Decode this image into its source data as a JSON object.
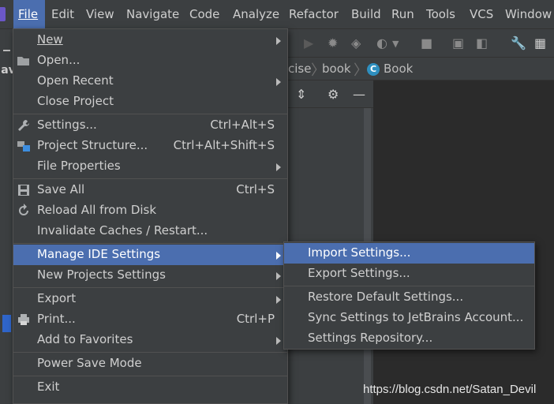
{
  "menubar": {
    "items": [
      "File",
      "Edit",
      "View",
      "Navigate",
      "Code",
      "Analyze",
      "Refactor",
      "Build",
      "Run",
      "Tools",
      "VCS",
      "Window"
    ],
    "active": "File"
  },
  "breadcrumb": {
    "items": [
      "cise",
      "book",
      "Book"
    ]
  },
  "sidebar": {
    "label": "Jav"
  },
  "file_menu": {
    "items": [
      {
        "label": "New",
        "shortcut": "",
        "submenu": true,
        "icon": ""
      },
      {
        "label": "Open...",
        "shortcut": "",
        "submenu": false,
        "icon": "folder-open-icon"
      },
      {
        "label": "Open Recent",
        "shortcut": "",
        "submenu": true,
        "icon": ""
      },
      {
        "label": "Close Project",
        "shortcut": "",
        "submenu": false,
        "icon": ""
      },
      {
        "label": "Settings...",
        "shortcut": "Ctrl+Alt+S",
        "submenu": false,
        "icon": "wrench-icon"
      },
      {
        "label": "Project Structure...",
        "shortcut": "Ctrl+Alt+Shift+S",
        "submenu": false,
        "icon": "project-structure-icon"
      },
      {
        "label": "File Properties",
        "shortcut": "",
        "submenu": true,
        "icon": ""
      },
      {
        "label": "Save All",
        "shortcut": "Ctrl+S",
        "submenu": false,
        "icon": "save-icon"
      },
      {
        "label": "Reload All from Disk",
        "shortcut": "",
        "submenu": false,
        "icon": "reload-icon"
      },
      {
        "label": "Invalidate Caches / Restart...",
        "shortcut": "",
        "submenu": false,
        "icon": ""
      },
      {
        "label": "Manage IDE Settings",
        "shortcut": "",
        "submenu": true,
        "icon": ""
      },
      {
        "label": "New Projects Settings",
        "shortcut": "",
        "submenu": true,
        "icon": ""
      },
      {
        "label": "Export",
        "shortcut": "",
        "submenu": true,
        "icon": ""
      },
      {
        "label": "Print...",
        "shortcut": "Ctrl+P",
        "submenu": false,
        "icon": "print-icon"
      },
      {
        "label": "Add to Favorites",
        "shortcut": "",
        "submenu": true,
        "icon": ""
      },
      {
        "label": "Power Save Mode",
        "shortcut": "",
        "submenu": false,
        "icon": ""
      },
      {
        "label": "Exit",
        "shortcut": "",
        "submenu": false,
        "icon": ""
      }
    ],
    "highlighted": "Manage IDE Settings"
  },
  "submenu": {
    "items": [
      "Import Settings...",
      "Export Settings...",
      "Restore Default Settings...",
      "Sync Settings to JetBrains Account...",
      "Settings Repository..."
    ],
    "highlighted": "Import Settings..."
  },
  "watermark": "https://blog.csdn.net/Satan_Devil",
  "colors": {
    "menu_bg": "#3c3f41",
    "highlight": "#4b6eaf",
    "editor_bg": "#2b2b2b",
    "text": "#cfcfcf"
  }
}
